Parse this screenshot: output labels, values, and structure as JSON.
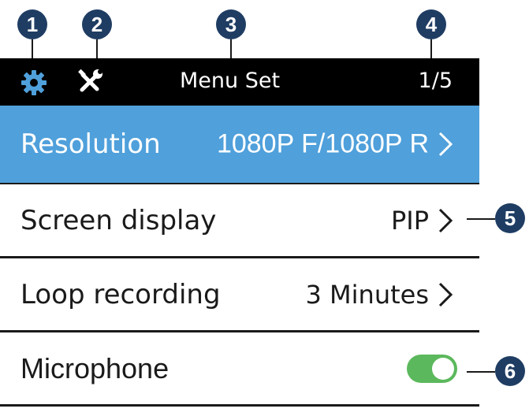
{
  "callouts": [
    "1",
    "2",
    "3",
    "4",
    "5",
    "6"
  ],
  "statusbar": {
    "title": "Menu Set",
    "page": "1/5",
    "settings_icon": "gear-icon",
    "tools_icon": "tools-icon"
  },
  "menu": {
    "resolution": {
      "label": "Resolution",
      "value": "1080P F/1080P R"
    },
    "screen_display": {
      "label": "Screen display",
      "value": "PIP"
    },
    "loop_recording": {
      "label": "Loop recording",
      "value": "3 Minutes"
    },
    "microphone": {
      "label": "Microphone",
      "enabled": true
    }
  },
  "colors": {
    "selected_row": "#4fa0db",
    "statusbar": "#000000",
    "toggle_on": "#5cb85c",
    "gear": "#4fa0db",
    "callout": "#1f3d63"
  }
}
